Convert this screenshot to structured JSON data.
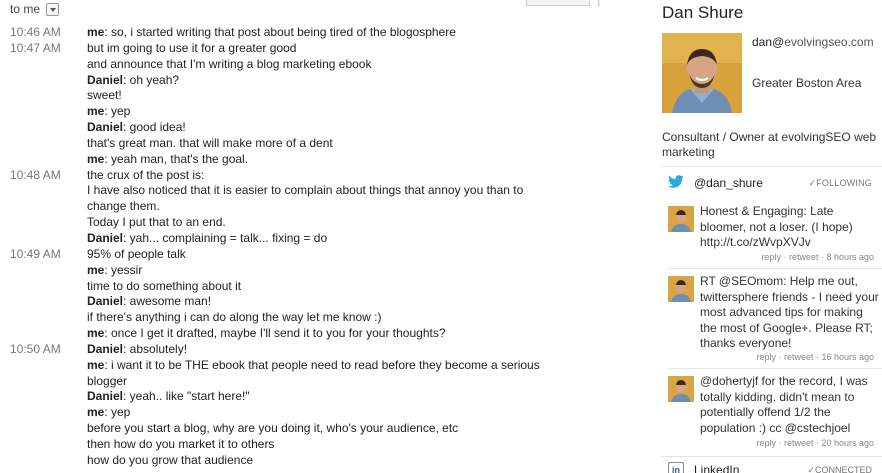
{
  "header": {
    "to_label": "to me"
  },
  "messages": [
    {
      "time": "10:46 AM",
      "speaker": "me",
      "text": ": so, i started writing that post about being tired of the blogosphere"
    },
    {
      "time": "10:47 AM",
      "speaker": "",
      "text": "but im going to use it for a greater good"
    },
    {
      "time": "",
      "speaker": "",
      "text": "and announce that I'm writing a blog marketing ebook"
    },
    {
      "time": "",
      "speaker": "Daniel",
      "text": ": oh yeah?"
    },
    {
      "time": "",
      "speaker": "",
      "text": "sweet!"
    },
    {
      "time": "",
      "speaker": "me",
      "text": ": yep"
    },
    {
      "time": "",
      "speaker": "Daniel",
      "text": ": good idea!"
    },
    {
      "time": "",
      "speaker": "",
      "text": "that's great man. that will make more of a dent"
    },
    {
      "time": "",
      "speaker": "me",
      "text": ": yeah man, that's the goal."
    },
    {
      "time": "10:48 AM",
      "speaker": "",
      "text": "the crux of the post is:"
    },
    {
      "time": "",
      "speaker": "",
      "text": "I have also noticed that it is easier to complain about things that annoy you than to"
    },
    {
      "time": "",
      "speaker": "",
      "text": "change them."
    },
    {
      "time": "",
      "speaker": "",
      "text": "Today I put that to an end."
    },
    {
      "time": "",
      "speaker": "Daniel",
      "text": ": yah... complaining = talk... fixing = do"
    },
    {
      "time": "10:49 AM",
      "speaker": "",
      "text": "95% of people talk"
    },
    {
      "time": "",
      "speaker": "me",
      "text": ": yessir"
    },
    {
      "time": "",
      "speaker": "",
      "text": "time to do something about it"
    },
    {
      "time": "",
      "speaker": "Daniel",
      "text": ": awesome man!"
    },
    {
      "time": "",
      "speaker": "",
      "text": "if there's anything i can do along the way let me know :)"
    },
    {
      "time": "",
      "speaker": "me",
      "text": ": once I get it drafted, maybe I'll send it to you for your thoughts?"
    },
    {
      "time": "10:50 AM",
      "speaker": "Daniel",
      "text": ": absolutely!"
    },
    {
      "time": "",
      "speaker": "me",
      "text": ": i want it to be THE ebook that people need to read before they become a serious"
    },
    {
      "time": "",
      "speaker": "",
      "text": "blogger"
    },
    {
      "time": "",
      "speaker": "Daniel",
      "text": ": yeah.. like \"start here!\""
    },
    {
      "time": "",
      "speaker": "me",
      "text": ": yep"
    },
    {
      "time": "",
      "speaker": "",
      "text": "before you start a blog, why are you doing it, who's your audience, etc"
    },
    {
      "time": "",
      "speaker": "",
      "text": "then how do you market it to others"
    },
    {
      "time": "",
      "speaker": "",
      "text": "how do you grow that audience"
    }
  ],
  "contact": {
    "name": "Dan Shure",
    "email_user": "dan@",
    "email_domain": "evolvingseo.com",
    "location": "Greater Boston Area",
    "occupation": "Consultant / Owner at evolvingSEO web marketing"
  },
  "twitter": {
    "handle": "@dan_shure",
    "status": "✓FOLLOWING",
    "tweets": [
      {
        "text": "Honest & Engaging: Late bloomer, not a loser. (I hope) http://t.co/zWvpXVJv",
        "meta": "reply · retweet · 8 hours ago"
      },
      {
        "text": "RT @SEOmom: Help me out, twittersphere friends - I need your most advanced tips for making the most of Google+. Please RT; thanks everyone!",
        "meta": "reply · retweet · 16 hours ago"
      },
      {
        "text": "@dohertyjf for the record, I was totally kidding. didn't mean to potentially offend 1/2 the population :) cc @cstechjoel",
        "meta": "reply · retweet · 20 hours ago"
      }
    ]
  },
  "linkedin": {
    "label": "LinkedIn",
    "status": "✓CONNECTED"
  },
  "colors": {
    "twitter_blue": "#2aa9e0",
    "linkedin_blue": "#2a5ea8",
    "avatar_bg": "#d7a23c"
  }
}
